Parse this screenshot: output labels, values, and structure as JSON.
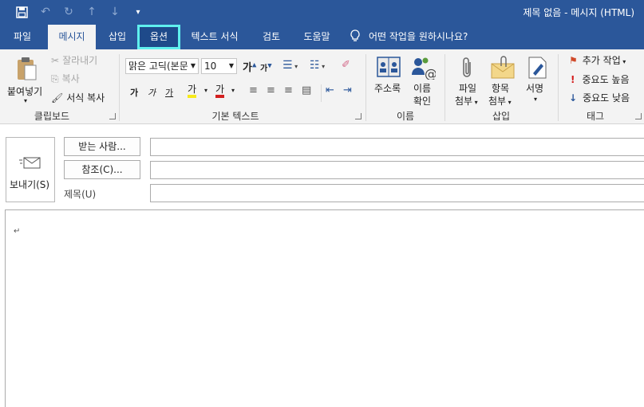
{
  "titlebar": {
    "title": "제목 없음  -  메시지 (HTML)",
    "quick_access": [
      "save-icon",
      "undo-icon",
      "redo-icon",
      "up-icon",
      "down-icon",
      "customize-icon"
    ]
  },
  "tabs": [
    {
      "label": "파일"
    },
    {
      "label": "메시지"
    },
    {
      "label": "삽입"
    },
    {
      "label": "옵션"
    },
    {
      "label": "텍스트 서식"
    },
    {
      "label": "검토"
    },
    {
      "label": "도움말"
    }
  ],
  "tell_me": "어떤 작업을 원하시나요?",
  "clipboard": {
    "paste": "붙여넣기",
    "cut": "잘라내기",
    "copy": "복사",
    "format_painter": "서식 복사",
    "group": "클립보드"
  },
  "basic_text": {
    "font": "맑은 고딕(본문",
    "size": "10",
    "grow": "가",
    "shrink": "가",
    "bold": "가",
    "italic": "가",
    "underline": "가",
    "highlight": "가",
    "font_color": "가",
    "group": "기본 텍스트"
  },
  "names": {
    "address_book": "주소록",
    "check_names": "이름\n확인",
    "check_names_1": "이름",
    "check_names_2": "확인",
    "group": "이름"
  },
  "include": {
    "attach_file_1": "파일",
    "attach_file_2": "첨부",
    "attach_item_1": "항목",
    "attach_item_2": "첨부",
    "signature": "서명",
    "group": "삽입"
  },
  "tags": {
    "follow_up": "추가 작업",
    "high": "중요도 높음",
    "low": "중요도 낮음",
    "group": "태그"
  },
  "header": {
    "send": "보내기(S)",
    "to": "받는 사람...",
    "cc": "참조(C)...",
    "subject": "제목(U)"
  },
  "body": {
    "mark": "↵"
  },
  "colors": {
    "accent": "#2b579a",
    "highlight_border": "#5ff0ee"
  }
}
